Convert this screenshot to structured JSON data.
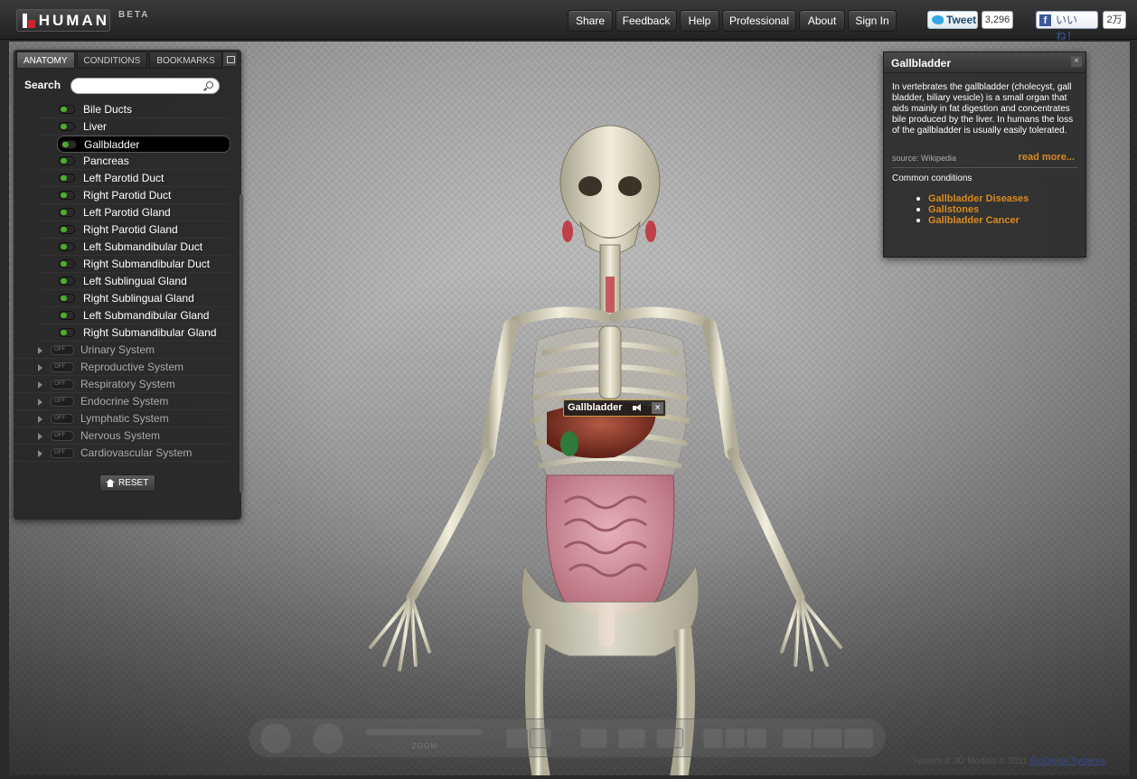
{
  "brand": {
    "name": "HUMAN",
    "badge": "BETA"
  },
  "nav": [
    "Share",
    "Feedback",
    "Help",
    "Professional",
    "About",
    "Sign In"
  ],
  "social": {
    "tweet_label": "Tweet",
    "tweet_count": "3,296",
    "like_label": "いいね！",
    "like_count": "2万"
  },
  "sidebar": {
    "tabs": [
      "ANATOMY",
      "CONDITIONS",
      "BOOKMARKS"
    ],
    "search_label": "Search",
    "search_value": "",
    "items": [
      "Bile Ducts",
      "Liver",
      "Gallbladder",
      "Pancreas",
      "Left Parotid Duct",
      "Right Parotid Duct",
      "Left Parotid Gland",
      "Right Parotid Gland",
      "Left Submandibular Duct",
      "Right Submandibular Duct",
      "Left Sublingual Gland",
      "Right Sublingual Gland",
      "Left Submandibular Gland",
      "Right Submandibular Gland"
    ],
    "selected_item": "Gallbladder",
    "groups": [
      "Urinary System",
      "Reproductive System",
      "Respiratory System",
      "Endocrine System",
      "Lymphatic System",
      "Nervous System",
      "Cardiovascular System"
    ],
    "off_label": "OFF",
    "reset_label": "RESET"
  },
  "info": {
    "title": "Gallbladder",
    "close": "×",
    "text": "In vertebrates the gallbladder (cholecyst, gall bladder, biliary vesicle) is a small organ that aids mainly in fat digestion and concentrates bile produced by the liver. In humans the loss of the gallbladder is usually easily tolerated.",
    "source": "source: Wikipedia",
    "more": "read more...",
    "conditions_title": "Common conditions",
    "conditions": [
      "Gallbladder Diseases",
      "Gallstones",
      "Gallbladder Cancer"
    ]
  },
  "tag": {
    "label": "Gallbladder",
    "close": "×"
  },
  "controls": {
    "zoom_label": "ZOOM"
  },
  "footer": {
    "text": "System & 3D Models © 2011 ",
    "link": "BioDigital Systems"
  },
  "colors": {
    "accent": "#d98a1f",
    "toggle_on": "#4caf2c",
    "brand_red": "#c8262e"
  }
}
